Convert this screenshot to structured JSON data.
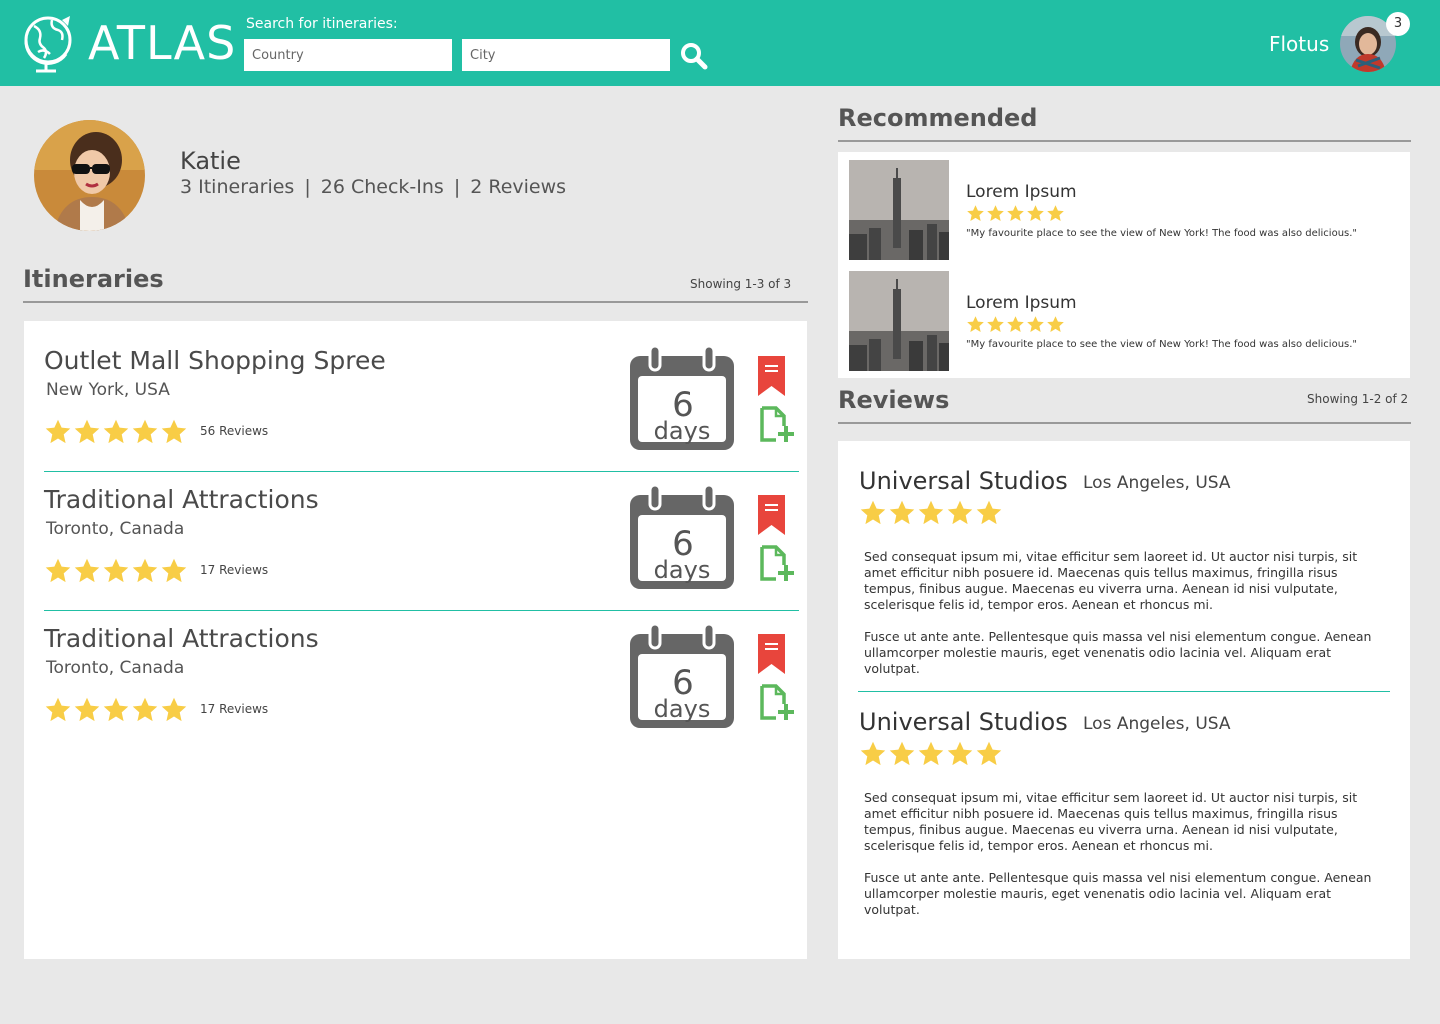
{
  "header": {
    "logo_text": "ATLAS",
    "search_label": "Search for itineraries:",
    "country_placeholder": "Country",
    "city_placeholder": "City",
    "user_name": "Flotus",
    "notification_count": "3"
  },
  "profile": {
    "name": "Katie",
    "itineraries": "3 Itineraries",
    "checkins": "26 Check-Ins",
    "reviews": "2 Reviews",
    "separator": "|"
  },
  "itineraries": {
    "heading": "Itineraries",
    "showing": "Showing 1-3 of 3",
    "items": [
      {
        "title": "Outlet Mall Shopping Spree",
        "location": "New York, USA",
        "rating": 5,
        "reviews": "56 Reviews",
        "duration_number": "6",
        "duration_unit": "days"
      },
      {
        "title": "Traditional Attractions",
        "location": "Toronto, Canada",
        "rating": 5,
        "reviews": "17 Reviews",
        "duration_number": "6",
        "duration_unit": "days"
      },
      {
        "title": "Traditional Attractions",
        "location": "Toronto, Canada",
        "rating": 5,
        "reviews": "17 Reviews",
        "duration_number": "6",
        "duration_unit": "days"
      }
    ]
  },
  "recommended": {
    "heading": "Recommended",
    "items": [
      {
        "title": "Lorem Ipsum",
        "rating": 5,
        "quote": "\"My favourite place to see the view of New York! The food was also delicious.\""
      },
      {
        "title": "Lorem Ipsum",
        "rating": 5,
        "quote": "\"My favourite place to see the view of New York! The food was also delicious.\""
      }
    ]
  },
  "reviews": {
    "heading": "Reviews",
    "showing": "Showing 1-2 of 2",
    "items": [
      {
        "title": "Universal Studios",
        "location": "Los Angeles, USA",
        "rating": 5,
        "p1": "Sed consequat ipsum mi, vitae efficitur sem laoreet id. Ut auctor nisi turpis, sit amet efficitur nibh posuere id. Maecenas quis tellus maximus, fringilla risus tempus, finibus augue. Maecenas eu viverra urna. Aenean id nisi vulputate, scelerisque felis id, tempor eros. Aenean et rhoncus mi.",
        "p2": "Fusce ut ante ante. Pellentesque quis massa vel nisi elementum congue. Aenean ullamcorper molestie mauris, eget venenatis odio lacinia vel. Aliquam erat volutpat."
      },
      {
        "title": "Universal Studios",
        "location": "Los Angeles, USA",
        "rating": 5,
        "p1": "Sed consequat ipsum mi, vitae efficitur sem laoreet id. Ut auctor nisi turpis, sit amet efficitur nibh posuere id. Maecenas quis tellus maximus, fringilla risus tempus, finibus augue. Maecenas eu viverra urna. Aenean id nisi vulputate, scelerisque felis id, tempor eros. Aenean et rhoncus mi.",
        "p2": "Fusce ut ante ante. Pellentesque quis massa vel nisi elementum congue. Aenean ullamcorper molestie mauris, eget venenatis odio lacinia vel. Aliquam erat volutpat."
      }
    ]
  },
  "colors": {
    "brand": "#21bfa4",
    "star": "#f8cd46",
    "bookmark": "#e8453c",
    "add": "#5cb85c",
    "calendar": "#666666"
  },
  "icons": {
    "logo": "globe-icon",
    "search": "search-icon",
    "star": "star-icon",
    "calendar": "calendar-icon",
    "bookmark": "bookmark-icon",
    "add": "add-file-icon"
  }
}
